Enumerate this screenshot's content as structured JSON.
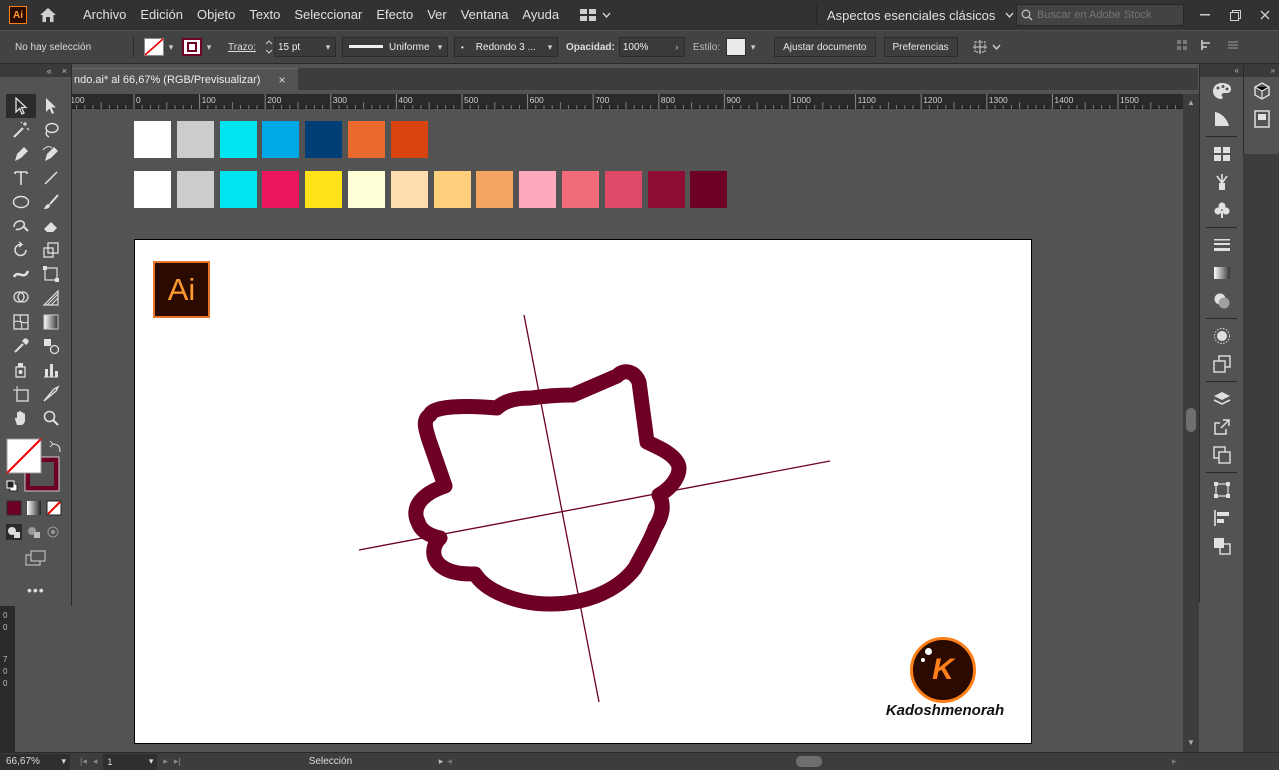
{
  "app": {
    "logo_text": "Ai",
    "menu": [
      "Archivo",
      "Edición",
      "Objeto",
      "Texto",
      "Seleccionar",
      "Efecto",
      "Ver",
      "Ventana",
      "Ayuda"
    ],
    "workspace": "Aspectos esenciales clásicos",
    "search_placeholder": "Buscar en Adobe Stock"
  },
  "control": {
    "selection": "No hay selección",
    "stroke_label": "Trazo:",
    "stroke_value": "15 pt",
    "profile": "Uniforme",
    "brush": "Redondo 3 ...",
    "opacity_label": "Opacidad:",
    "opacity_value": "100%",
    "style_label": "Estilo:",
    "fit_doc_button": "Ajustar documento",
    "prefs_button": "Preferencias"
  },
  "document": {
    "tab_title": "ndo.ai* al 66,67% (RGB/Previsualizar)",
    "close": "×"
  },
  "ruler": {
    "ticks": [
      "100",
      "0",
      "100",
      "200",
      "300",
      "400",
      "500",
      "600",
      "700",
      "800",
      "900",
      "1000",
      "1100",
      "1200",
      "1300",
      "1400",
      "1500"
    ],
    "left_ticks": [
      "0",
      "0",
      "7",
      "0",
      "0"
    ]
  },
  "swatches": {
    "row1": [
      "#ffffff",
      "#cccccc",
      "#00e5ef",
      "#00a8e6",
      "#003e78",
      "#ea6a2e",
      "#d84310"
    ],
    "row2": [
      "#ffffff",
      "#cccccc",
      "#00e5ef",
      "#ee1560",
      "#ffe21a",
      "#ffffd8",
      "#ffdcae",
      "#ffcf7c",
      "#f4a55f",
      "#ffaabc",
      "#f26b7a",
      "#dd4a68",
      "#8c0c34",
      "#6e0026"
    ]
  },
  "artwork": {
    "stroke_color": "#6e0026",
    "ai_logo_text": "Ai",
    "brand_letter": "K",
    "brand_name": "Kadoshmenorah"
  },
  "status": {
    "zoom": "66,67%",
    "artboard": "1",
    "tool": "Selección"
  }
}
